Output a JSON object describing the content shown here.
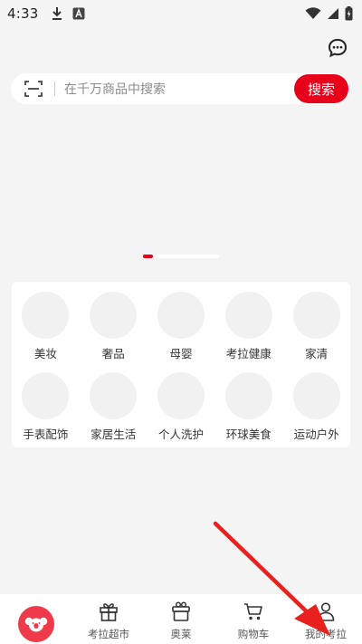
{
  "status_bar": {
    "time": "4:33",
    "left_icons": [
      "download-icon",
      "a-badge-icon"
    ],
    "right_icons": [
      "wifi-icon",
      "signal-icon",
      "battery-charging-icon"
    ]
  },
  "header": {
    "message_icon": "chat-bubble-icon"
  },
  "search": {
    "scan_icon": "scan-icon",
    "placeholder": "在千万商品中搜索",
    "button_label": "搜索"
  },
  "banner": {
    "indicator_active_index": 0
  },
  "categories": [
    {
      "label": "美妆"
    },
    {
      "label": "奢品"
    },
    {
      "label": "母婴"
    },
    {
      "label": "考拉健康"
    },
    {
      "label": "家清"
    },
    {
      "label": "手表配饰"
    },
    {
      "label": "家居生活"
    },
    {
      "label": "个人洗护"
    },
    {
      "label": "环球美食"
    },
    {
      "label": "运动户外"
    }
  ],
  "bottom_nav": {
    "items": [
      {
        "label": "",
        "icon": "koala-home-icon"
      },
      {
        "label": "考拉超市",
        "icon": "gift-icon"
      },
      {
        "label": "奥莱",
        "icon": "gift-box-icon"
      },
      {
        "label": "购物车",
        "icon": "cart-icon"
      },
      {
        "label": "我的考拉",
        "icon": "person-icon"
      }
    ]
  },
  "colors": {
    "accent": "#e8001b",
    "background": "#f4f4f4",
    "card": "#ffffff",
    "annotation": "#e8201e"
  }
}
